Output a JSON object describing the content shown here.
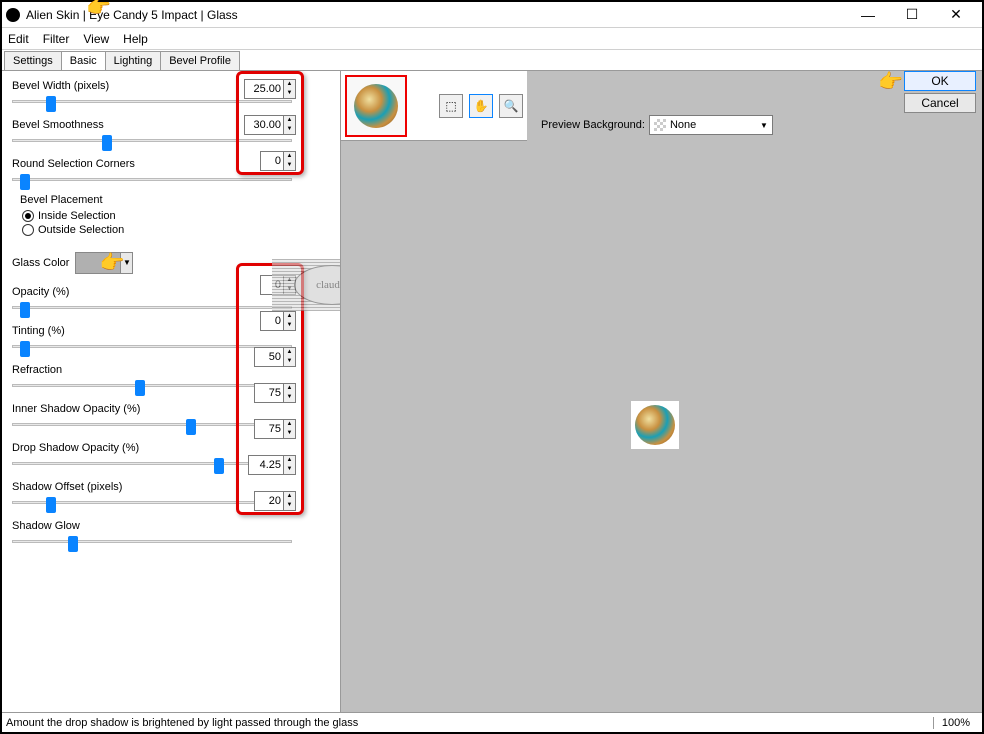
{
  "title": "Alien Skin | Eye Candy 5 Impact | Glass",
  "menus": [
    "Edit",
    "Filter",
    "View",
    "Help"
  ],
  "tabs": [
    "Settings",
    "Basic",
    "Lighting",
    "Bevel Profile"
  ],
  "active_tab": 1,
  "params": {
    "bevel_width": {
      "label": "Bevel Width (pixels)",
      "value": "25.00",
      "thumb": 12
    },
    "bevel_smoothness": {
      "label": "Bevel Smoothness",
      "value": "30.00",
      "thumb": 32
    },
    "round_corners": {
      "label": "Round Selection Corners",
      "value": "0",
      "thumb": 3
    },
    "opacity": {
      "label": "Opacity (%)",
      "value": "0",
      "thumb": 3
    },
    "tinting": {
      "label": "Tinting (%)",
      "value": "0",
      "thumb": 3
    },
    "refraction": {
      "label": "Refraction",
      "value": "50",
      "thumb": 44
    },
    "inner_shadow": {
      "label": "Inner Shadow Opacity (%)",
      "value": "75",
      "thumb": 62
    },
    "drop_shadow": {
      "label": "Drop Shadow Opacity (%)",
      "value": "75",
      "thumb": 72
    },
    "shadow_offset": {
      "label": "Shadow Offset (pixels)",
      "value": "4.25",
      "thumb": 12
    },
    "shadow_glow": {
      "label": "Shadow Glow",
      "value": "20",
      "thumb": 20
    }
  },
  "bevel_placement": {
    "label": "Bevel Placement",
    "options": [
      "Inside Selection",
      "Outside Selection"
    ],
    "selected": 0
  },
  "glass_color_label": "Glass Color",
  "preview_bg": {
    "label": "Preview Background:",
    "value": "None"
  },
  "buttons": {
    "ok": "OK",
    "cancel": "Cancel"
  },
  "status": "Amount the drop shadow is brightened by light passed through the glass",
  "zoom": "100%",
  "watermark": "claudia"
}
